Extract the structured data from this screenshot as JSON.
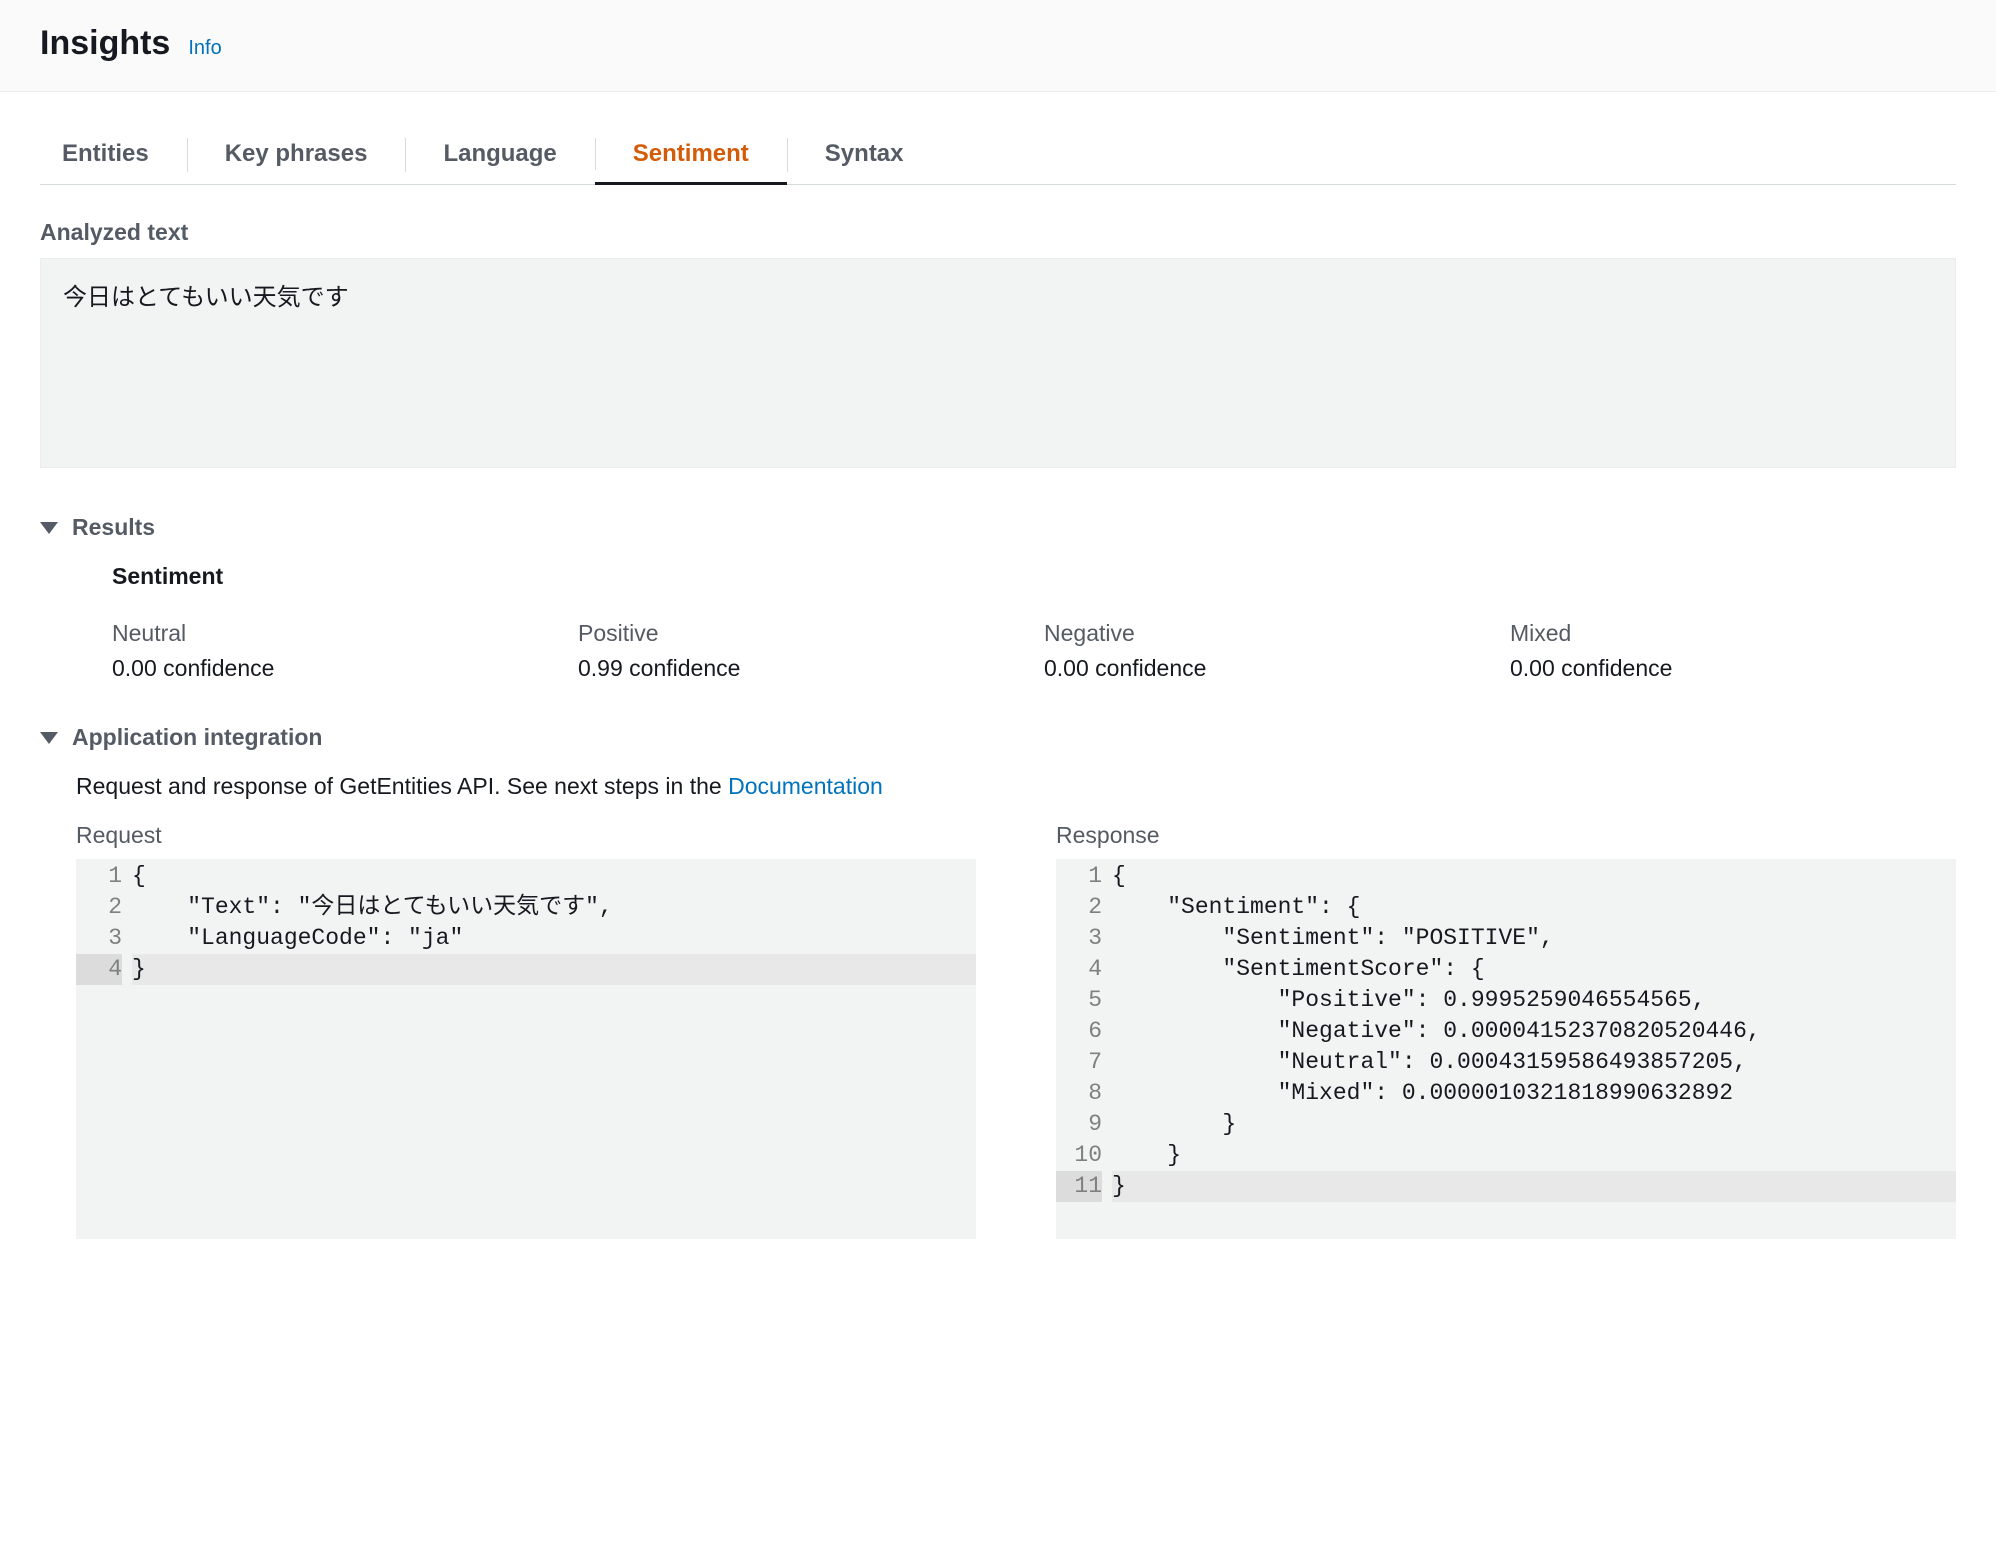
{
  "header": {
    "title": "Insights",
    "info": "Info"
  },
  "tabs": {
    "entities": "Entities",
    "key_phrases": "Key phrases",
    "language": "Language",
    "sentiment": "Sentiment",
    "syntax": "Syntax"
  },
  "analyzed": {
    "label": "Analyzed text",
    "text": "今日はとてもいい天気です"
  },
  "results": {
    "title": "Results",
    "sentiment_heading": "Sentiment",
    "cols": [
      {
        "name": "Neutral",
        "conf": "0.00 confidence"
      },
      {
        "name": "Positive",
        "conf": "0.99 confidence"
      },
      {
        "name": "Negative",
        "conf": "0.00 confidence"
      },
      {
        "name": "Mixed",
        "conf": "0.00 confidence"
      }
    ]
  },
  "appint": {
    "title": "Application integration",
    "desc_prefix": "Request and response of GetEntities API. See next steps in the ",
    "doc_link": "Documentation",
    "request_label": "Request",
    "response_label": "Response",
    "request_lines": [
      "{",
      "    \"Text\": \"今日はとてもいい天気です\",",
      "    \"LanguageCode\": \"ja\"",
      "}"
    ],
    "response_lines": [
      "{",
      "    \"Sentiment\": {",
      "        \"Sentiment\": \"POSITIVE\",",
      "        \"SentimentScore\": {",
      "            \"Positive\": 0.9995259046554565,",
      "            \"Negative\": 0.00004152370820520446,",
      "            \"Neutral\": 0.00043159586493857205,",
      "            \"Mixed\": 0.0000010321818990632892",
      "        }",
      "    }",
      "}"
    ]
  }
}
